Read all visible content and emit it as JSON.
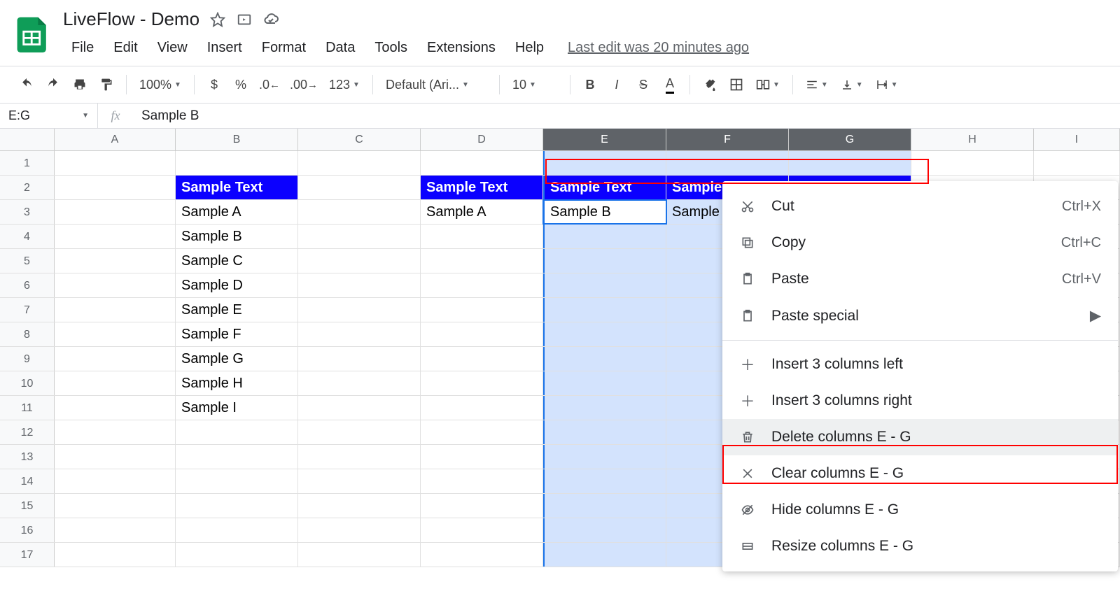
{
  "doc": {
    "title": "LiveFlow - Demo"
  },
  "last_edit": "Last edit was 20 minutes ago",
  "menus": [
    "File",
    "Edit",
    "View",
    "Insert",
    "Format",
    "Data",
    "Tools",
    "Extensions",
    "Help"
  ],
  "toolbar": {
    "zoom": "100%",
    "font": "Default (Ari...",
    "font_size": "10",
    "text_color_letter": "A"
  },
  "formula_bar": {
    "name_box": "E:G",
    "fx": "fx",
    "value": "Sample B"
  },
  "columns": [
    "A",
    "B",
    "C",
    "D",
    "E",
    "F",
    "G",
    "H",
    "I"
  ],
  "rows": [
    1,
    2,
    3,
    4,
    5,
    6,
    7,
    8,
    9,
    10,
    11,
    12,
    13,
    14,
    15,
    16,
    17
  ],
  "selected_cols": [
    "E",
    "F",
    "G"
  ],
  "cells": {
    "B2": {
      "v": "Sample Text",
      "hdr": true
    },
    "D2": {
      "v": "Sample Text",
      "hdr": true
    },
    "E2": {
      "v": "Sample Text",
      "hdr": true
    },
    "F2": {
      "v": "Sample Text",
      "hdr": true
    },
    "G2": {
      "v": "",
      "hdr": true
    },
    "B3": {
      "v": "Sample A"
    },
    "D3": {
      "v": "Sample A"
    },
    "E3": {
      "v": "Sample B",
      "active": true
    },
    "F3": {
      "v": "Sample C"
    },
    "B4": {
      "v": "Sample B"
    },
    "B5": {
      "v": "Sample C"
    },
    "B6": {
      "v": "Sample D"
    },
    "B7": {
      "v": "Sample E"
    },
    "B8": {
      "v": "Sample F"
    },
    "B9": {
      "v": "Sample G"
    },
    "B10": {
      "v": "Sample H"
    },
    "B11": {
      "v": "Sample I"
    }
  },
  "context_menu": {
    "cut": "Cut",
    "cut_sc": "Ctrl+X",
    "copy": "Copy",
    "copy_sc": "Ctrl+C",
    "paste": "Paste",
    "paste_sc": "Ctrl+V",
    "paste_special": "Paste special",
    "insert_left": "Insert 3 columns left",
    "insert_right": "Insert 3 columns right",
    "delete_cols": "Delete columns E - G",
    "clear_cols": "Clear columns E - G",
    "hide_cols": "Hide columns E - G",
    "resize_cols": "Resize columns E - G"
  }
}
